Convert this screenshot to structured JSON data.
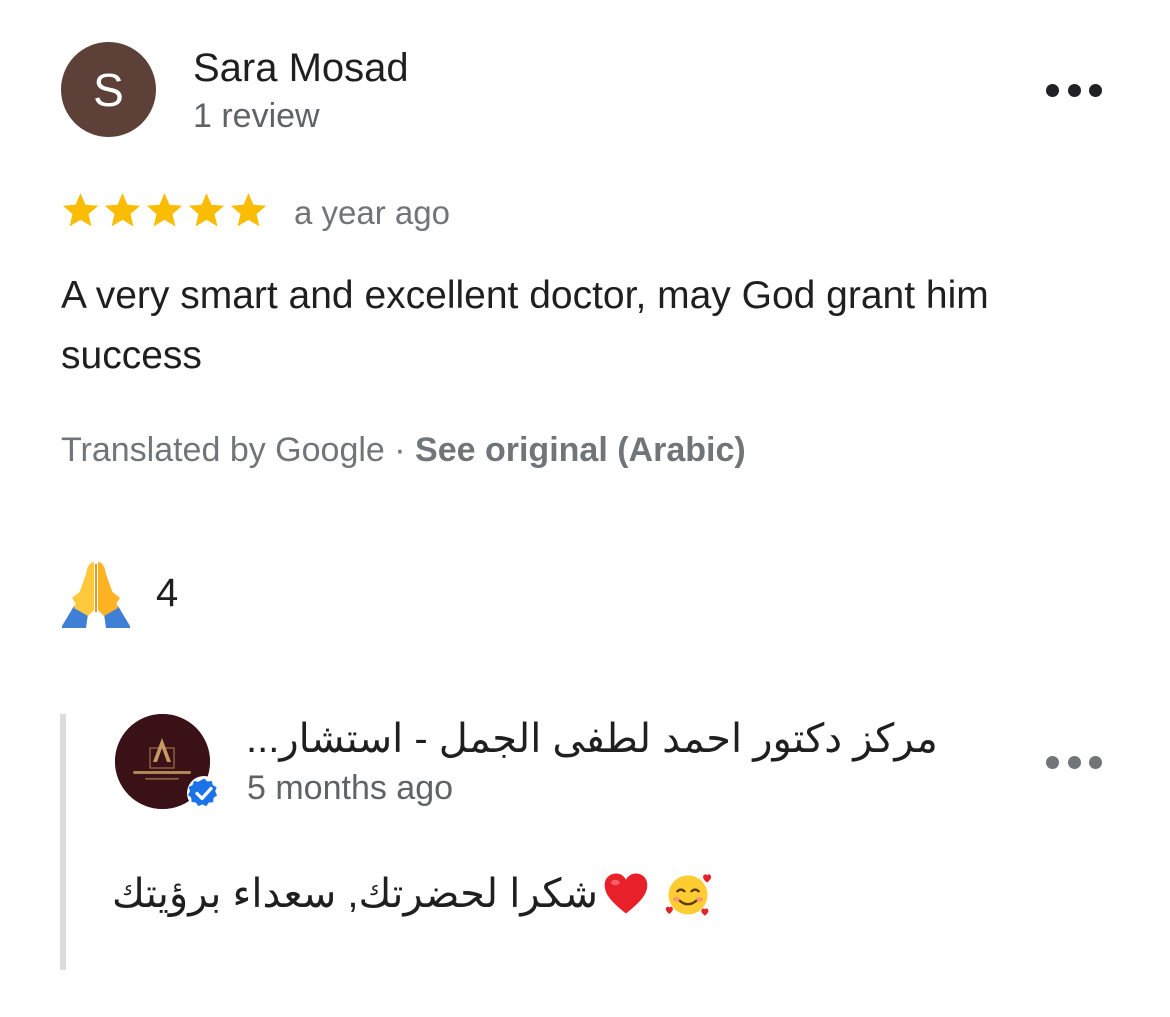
{
  "review": {
    "author_initial": "S",
    "author_name": "Sara Mosad",
    "author_review_count": "1 review",
    "rating": 5,
    "rating_max": 5,
    "time": "a year ago",
    "text": "A very smart and excellent doctor, may God grant him success",
    "translated_by": "Translated by Google",
    "separator": " · ",
    "see_original": "See original (Arabic)",
    "more_icon": "more-horizontal-icon"
  },
  "reaction": {
    "emoji_icon": "folded-hands-icon",
    "count": "4"
  },
  "owner_reply": {
    "name": "مركز دكتور احمد لطفى الجمل - استشار...",
    "time": "5 months ago",
    "text": "شكرا لحضرتك, سعداء برؤيتك",
    "logo_icon": "business-logo",
    "badge_icon": "verified-badge-icon",
    "emoji_icons": [
      "red-heart-icon",
      "smiling-face-with-hearts-icon"
    ],
    "more_icon": "more-horizontal-icon"
  },
  "colors": {
    "avatar_bg": "#5d4037",
    "star": "#fbbc04",
    "secondary_text": "#70757a",
    "reply_bar": "#dadce0",
    "verified": "#1a73e8",
    "owner_avatar_bg": "#3a1116"
  }
}
